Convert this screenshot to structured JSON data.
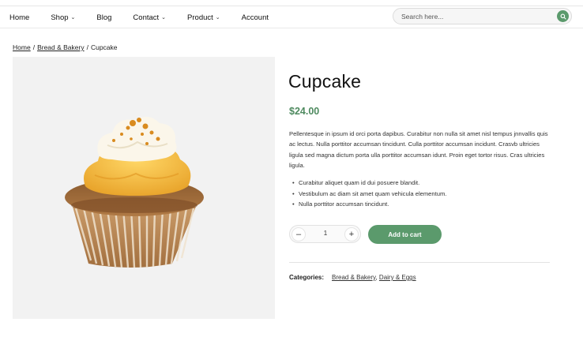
{
  "nav": {
    "items": [
      {
        "label": "Home"
      },
      {
        "label": "Shop",
        "chevron": "⌄"
      },
      {
        "label": "Blog"
      },
      {
        "label": "Contact",
        "chevron": "⌄"
      },
      {
        "label": "Product",
        "chevron": "⌄"
      },
      {
        "label": "Account"
      }
    ]
  },
  "search": {
    "placeholder": "Search here...",
    "icon": "search-icon"
  },
  "breadcrumb": {
    "home": "Home",
    "sep": "/",
    "category": "Bread & Bakery",
    "current": "Cupcake"
  },
  "product": {
    "title": "Cupcake",
    "price": "$24.00",
    "description": "Pellentesque in ipsum id orci porta dapibus. Curabitur non nulla sit amet nisl tempus jnnvallis quis ac lectus. Nulla porttitor accumsan tincidunt. Culla porttitor accumsan incidunt. Crasvb ultricies ligula sed magna dictum porta ulla porttitor accumsan idunt. Proin eget tortor risus. Cras ultricies ligula.",
    "features": [
      "Curabitur aliquet quam id dui posuere blandit.",
      "Vestibulum ac diam sit amet quam vehicula elementum.",
      "Nulla porttitor accumsan tincidunt."
    ],
    "quantity": "1",
    "minus": "–",
    "plus": "+",
    "add_to_cart": "Add to cart",
    "categories_label": "Categories:",
    "categories": [
      "Bread & Bakery",
      "Dairy & Eggs"
    ],
    "categories_sep": ","
  },
  "colors": {
    "accent": "#5b9a6c",
    "price": "#4e8a5f",
    "image_bg": "#f2f2f2"
  }
}
